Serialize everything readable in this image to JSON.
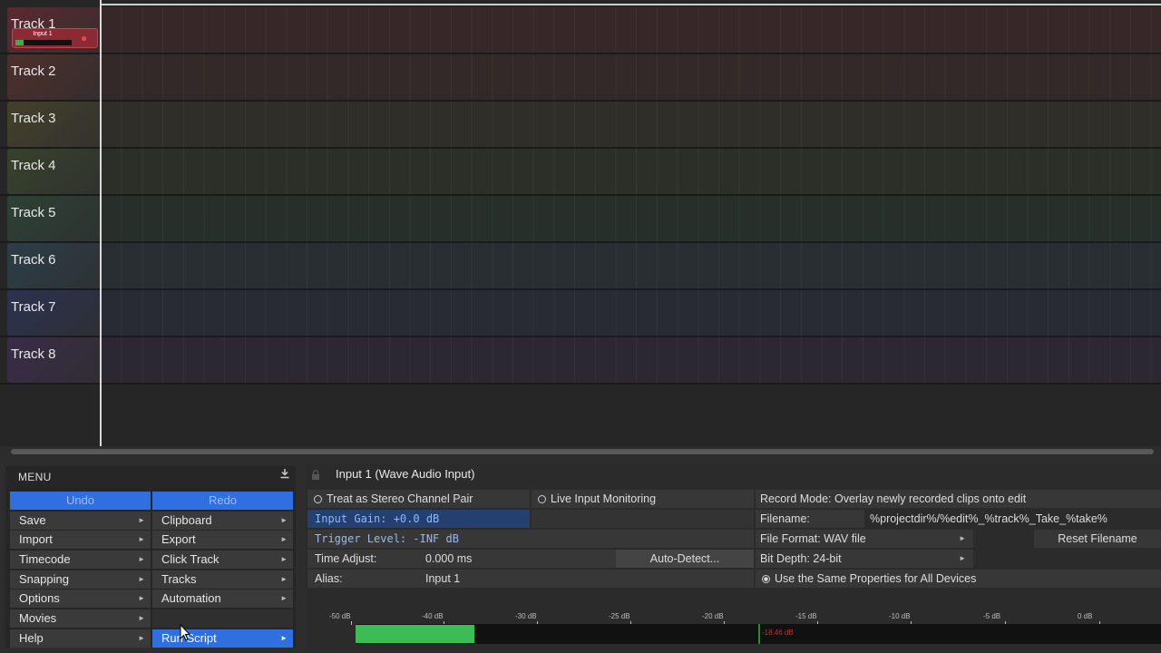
{
  "tracks": [
    {
      "name": "Track 1",
      "color": "#5a2a30"
    },
    {
      "name": "Track 2",
      "color": "#4d2f2c"
    },
    {
      "name": "Track 3",
      "color": "#45402c"
    },
    {
      "name": "Track 4",
      "color": "#37422c"
    },
    {
      "name": "Track 5",
      "color": "#2c4236"
    },
    {
      "name": "Track 6",
      "color": "#2c3e48"
    },
    {
      "name": "Track 7",
      "color": "#2c3250"
    },
    {
      "name": "Track 8",
      "color": "#3a2c48"
    }
  ],
  "track1_input_chip": {
    "label": "Input 1",
    "level": 0.15
  },
  "menu": {
    "title": "MENU",
    "undo": "Undo",
    "redo": "Redo",
    "left": [
      "Save",
      "Import",
      "Timecode",
      "Snapping",
      "Options",
      "Movies",
      "Help"
    ],
    "right": [
      "Clipboard",
      "Export",
      "Click Track",
      "Tracks",
      "Automation",
      "Run Script"
    ],
    "right_has_arrow": [
      true,
      true,
      true,
      true,
      true,
      true
    ],
    "left_has_arrow": [
      true,
      true,
      true,
      true,
      true,
      true,
      true
    ],
    "active": "Run Script"
  },
  "panel": {
    "title": "Input 1 (Wave Audio Input)",
    "stereo_pair": "Treat as Stereo Channel Pair",
    "live_monitoring": "Live Input Monitoring",
    "record_mode": "Record Mode: Overlay newly recorded clips onto edit",
    "input_gain": "Input Gain: +0.0 dB",
    "filename_label": "Filename:",
    "filename_value": "%projectdir%/%edit%_%track%_Take_%take%",
    "trigger_level": "Trigger Level: -INF dB",
    "file_format": "File Format: WAV file",
    "reset_filename": "Reset Filename",
    "time_adjust_label": "Time Adjust:",
    "time_adjust_value": "0.000 ms",
    "auto_detect": "Auto-Detect...",
    "bit_depth": "Bit Depth: 24-bit",
    "alias_label": "Alias:",
    "alias_value": "Input 1",
    "same_properties": "Use the Same Properties for All Devices"
  },
  "meter": {
    "scale": [
      "-50 dB",
      "-40 dB",
      "-30 dB",
      "-25 dB",
      "-20 dB",
      "-15 dB",
      "-10 dB",
      "-5 dB",
      "0 dB"
    ],
    "peak_label": "-18.46 dB",
    "level_fraction": 0.147
  },
  "colors": {
    "accent": "#2f6fe0",
    "meter": "#3dbb55",
    "record": "#c8404c"
  }
}
